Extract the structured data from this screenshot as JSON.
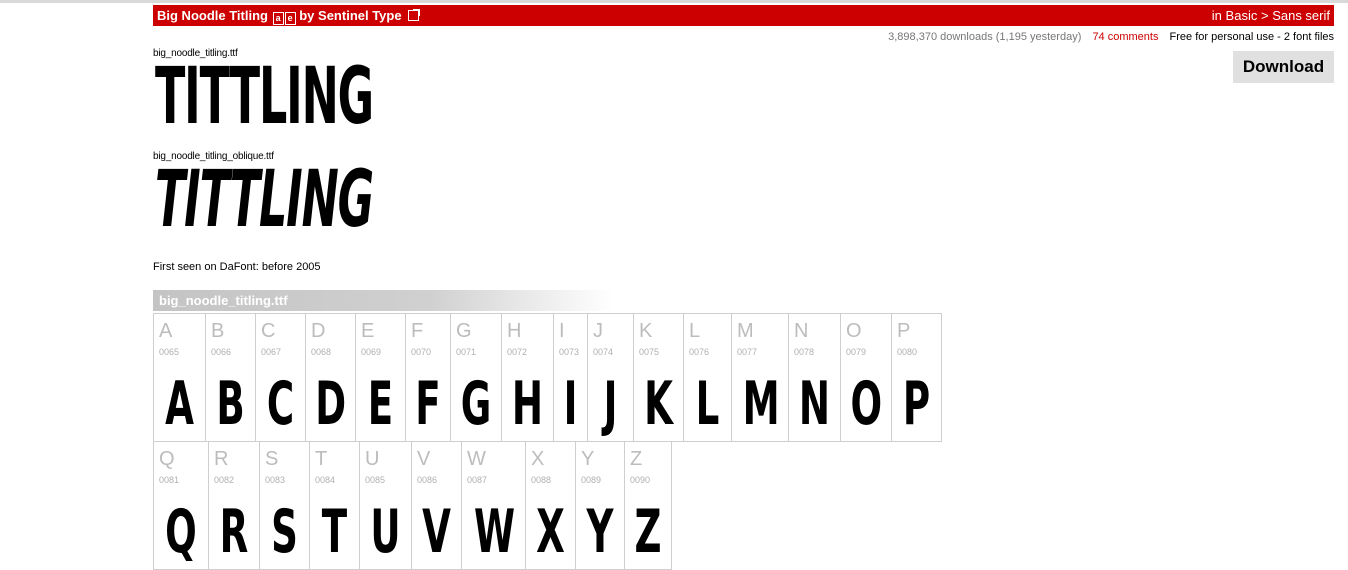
{
  "header": {
    "font_name": "Big Noodle Titling",
    "badge_1": "a",
    "badge_2": "e",
    "author_prefix": "by",
    "author": "Sentinel Type",
    "category_prefix": "in",
    "category": "Basic",
    "subcategory": "Sans serif",
    "separator": ">"
  },
  "stats": {
    "downloads": "3,898,370 downloads (1,195 yesterday)",
    "comments": "74 comments",
    "license": "Free for personal use - 2 font files"
  },
  "download_label": "Download",
  "previews": [
    {
      "filename": "big_noodle_titling.ttf",
      "text": "TITTLING"
    },
    {
      "filename": "big_noodle_titling_oblique.ttf",
      "text": "TITTLING"
    }
  ],
  "first_seen": "First seen on DaFont: before 2005",
  "charmap": {
    "title": "big_noodle_titling.ttf",
    "row1": [
      {
        "ch": "A",
        "code": "0065"
      },
      {
        "ch": "B",
        "code": "0066"
      },
      {
        "ch": "C",
        "code": "0067"
      },
      {
        "ch": "D",
        "code": "0068"
      },
      {
        "ch": "E",
        "code": "0069"
      },
      {
        "ch": "F",
        "code": "0070"
      },
      {
        "ch": "G",
        "code": "0071"
      },
      {
        "ch": "H",
        "code": "0072"
      },
      {
        "ch": "I",
        "code": "0073"
      },
      {
        "ch": "J",
        "code": "0074"
      },
      {
        "ch": "K",
        "code": "0075"
      },
      {
        "ch": "L",
        "code": "0076"
      },
      {
        "ch": "M",
        "code": "0077"
      },
      {
        "ch": "N",
        "code": "0078"
      },
      {
        "ch": "O",
        "code": "0079"
      },
      {
        "ch": "P",
        "code": "0080"
      }
    ],
    "row2": [
      {
        "ch": "Q",
        "code": "0081"
      },
      {
        "ch": "R",
        "code": "0082"
      },
      {
        "ch": "S",
        "code": "0083"
      },
      {
        "ch": "T",
        "code": "0084"
      },
      {
        "ch": "U",
        "code": "0085"
      },
      {
        "ch": "V",
        "code": "0086"
      },
      {
        "ch": "W",
        "code": "0087"
      },
      {
        "ch": "X",
        "code": "0088"
      },
      {
        "ch": "Y",
        "code": "0089"
      },
      {
        "ch": "Z",
        "code": "0090"
      }
    ]
  },
  "colors": {
    "accent": "#cc0000",
    "muted": "#777777"
  }
}
